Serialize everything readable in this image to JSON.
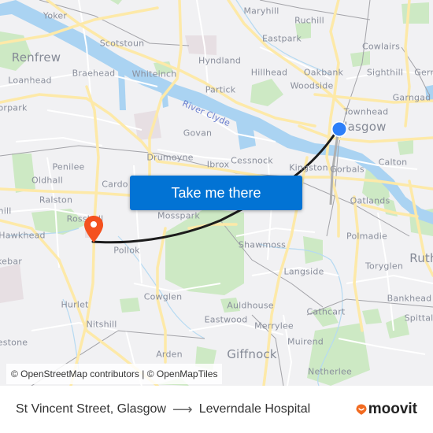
{
  "map": {
    "colors": {
      "background": "#f1f1f3",
      "water": "#aad3f2",
      "park": "#c9e8c0",
      "major_road": "#fde9a8",
      "minor_road": "#ffffff",
      "rail": "#a9a9a9",
      "route_line": "#1f1f1f",
      "origin_marker": "#2d7ff9",
      "destination_marker": "#f4511e"
    },
    "labels": [
      {
        "name": "yoker",
        "text": "Yoker"
      },
      {
        "name": "scotstoun",
        "text": "Scotstoun"
      },
      {
        "name": "renfrew",
        "text": "Renfrew"
      },
      {
        "name": "braehead",
        "text": "Braehead"
      },
      {
        "name": "whiteinch",
        "text": "Whiteinch"
      },
      {
        "name": "loanhead",
        "text": "Loanhead"
      },
      {
        "name": "moorpark",
        "text": "orpark"
      },
      {
        "name": "hyndland",
        "text": "Hyndland"
      },
      {
        "name": "partick",
        "text": "Partick"
      },
      {
        "name": "maryhill",
        "text": "Maryhill"
      },
      {
        "name": "ruchill",
        "text": "Ruchill"
      },
      {
        "name": "eastpark",
        "text": "Eastpark"
      },
      {
        "name": "cowlairs",
        "text": "Cowlairs"
      },
      {
        "name": "hillhead",
        "text": "Hillhead"
      },
      {
        "name": "oakbank",
        "text": "Oakbank"
      },
      {
        "name": "sighthill",
        "text": "Sighthill"
      },
      {
        "name": "germiston",
        "text": "Gern"
      },
      {
        "name": "woodside",
        "text": "Woodside"
      },
      {
        "name": "townhead",
        "text": "Townhead"
      },
      {
        "name": "garngad",
        "text": "Garngad"
      },
      {
        "name": "glasgow",
        "text": "Glasgow"
      },
      {
        "name": "govan",
        "text": "Govan"
      },
      {
        "name": "drumoyne",
        "text": "Drumoyne"
      },
      {
        "name": "ibrox",
        "text": "Ibrox"
      },
      {
        "name": "cessnock",
        "text": "Cessnock"
      },
      {
        "name": "kingston",
        "text": "Kingston"
      },
      {
        "name": "gorbals",
        "text": "Gorbals"
      },
      {
        "name": "calton",
        "text": "Calton"
      },
      {
        "name": "penilee",
        "text": "Penilee"
      },
      {
        "name": "oldhall",
        "text": "Oldhall"
      },
      {
        "name": "cardonald",
        "text": "Cardo"
      },
      {
        "name": "ralston",
        "text": "Ralston"
      },
      {
        "name": "crookston",
        "text": "hill"
      },
      {
        "name": "oatlands",
        "text": "Oatlands"
      },
      {
        "name": "rosshall",
        "text": "Rosshall"
      },
      {
        "name": "hawkhead",
        "text": "Hawkhead"
      },
      {
        "name": "mosspark",
        "text": "Mosspark"
      },
      {
        "name": "pollok",
        "text": "Pollok"
      },
      {
        "name": "polmadie",
        "text": "Polmadie"
      },
      {
        "name": "rutherglen",
        "text": "Ruth"
      },
      {
        "name": "shawmoss",
        "text": "Shawmoss"
      },
      {
        "name": "toryglen",
        "text": "Toryglen"
      },
      {
        "name": "brookebar",
        "text": "kebar"
      },
      {
        "name": "langside",
        "text": "Langside"
      },
      {
        "name": "cowglen",
        "text": "Cowglen"
      },
      {
        "name": "auldhouse",
        "text": "Auldhouse"
      },
      {
        "name": "bankhead",
        "text": "Bankhead"
      },
      {
        "name": "hurlet",
        "text": "Hurlet"
      },
      {
        "name": "cathcart",
        "text": "Cathcart"
      },
      {
        "name": "spittal",
        "text": "Spittal"
      },
      {
        "name": "eastwood",
        "text": "Eastwood"
      },
      {
        "name": "merrylee",
        "text": "Merrylee"
      },
      {
        "name": "nitshill",
        "text": "Nitshill"
      },
      {
        "name": "muirend",
        "text": "Muirend"
      },
      {
        "name": "darnley",
        "text": "estone"
      },
      {
        "name": "giffnock",
        "text": "Giffnock"
      },
      {
        "name": "arden",
        "text": "Arden"
      },
      {
        "name": "netherlee",
        "text": "Netherlee"
      },
      {
        "name": "river-clyde",
        "text": "River Clyde"
      }
    ],
    "markers": {
      "origin": {
        "label": "St Vincent Street, Glasgow"
      },
      "destination": {
        "label": "Leverndale Hospital"
      }
    },
    "cta_label": "Take me there",
    "attribution": "© OpenStreetMap contributors | © OpenMapTiles"
  },
  "footer": {
    "origin": "St Vincent Street, Glasgow",
    "arrow": "⟶",
    "destination": "Leverndale Hospital",
    "brand": "moovit",
    "brand_color": "#f26b21"
  }
}
